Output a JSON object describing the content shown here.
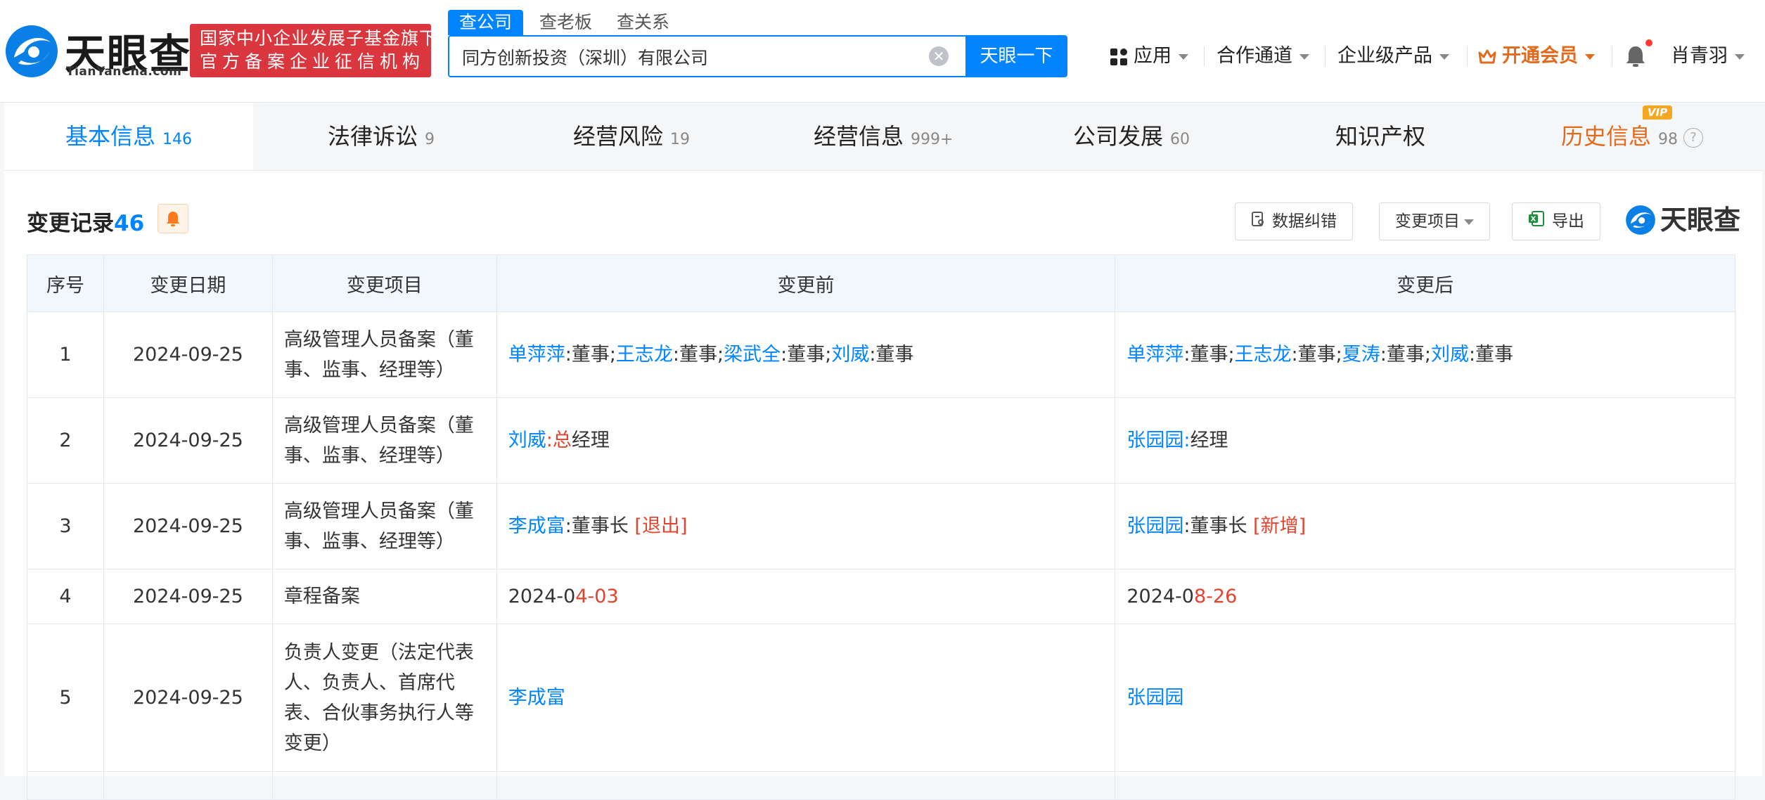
{
  "header": {
    "logo_cn": "天眼查",
    "logo_en": "TianYanCha.com",
    "badge_line1": "国家中小企业发展子基金旗下",
    "badge_line2": "官方备案企业征信机构",
    "search_tabs": [
      "查公司",
      "查老板",
      "查关系"
    ],
    "search_value": "同方创新投资（深圳）有限公司",
    "search_button": "天眼一下",
    "nav": {
      "apps": "应用",
      "cooperation": "合作通道",
      "enterprise": "企业级产品",
      "vip": "开通会员",
      "user": "肖青羽"
    },
    "accent_color": "#0084ff",
    "badge_color": "#d9363e"
  },
  "tabs": [
    {
      "label": "基本信息",
      "count": "146"
    },
    {
      "label": "法律诉讼",
      "count": "9"
    },
    {
      "label": "经营风险",
      "count": "19"
    },
    {
      "label": "经营信息",
      "count": "999+"
    },
    {
      "label": "公司发展",
      "count": "60"
    },
    {
      "label": "知识产权",
      "count": ""
    },
    {
      "label": "历史信息",
      "count": "98",
      "tag": "VIP"
    }
  ],
  "section": {
    "title": "变更记录",
    "count": "46",
    "buttons": {
      "correct": "数据纠错",
      "filter": "变更项目",
      "export": "导出"
    },
    "watermark": "天眼查"
  },
  "table": {
    "headers": [
      "序号",
      "变更日期",
      "变更项目",
      "变更前",
      "变更后"
    ],
    "rows": [
      {
        "no": "1",
        "date": "2024-09-25",
        "item": "高级管理人员备案（董事、监事、经理等）",
        "before": {
          "p1": "单萍萍",
          "t1": ":董事;",
          "p2": "王志龙",
          "t2": ":董事;",
          "p3": "梁武全",
          "t3": ":董事;",
          "p4": "刘威",
          "t4": ":董事"
        },
        "after": {
          "p1": "单萍萍",
          "t1": ":董事;",
          "p2": "王志龙",
          "t2": ":董事;",
          "p3": "夏涛",
          "t3": ":董事;",
          "p4": "刘威",
          "t4": ":董事"
        }
      },
      {
        "no": "2",
        "date": "2024-09-25",
        "item": "高级管理人员备案（董事、监事、经理等）",
        "before": {
          "name": "刘威",
          "hl": ":总",
          "rest": "经理"
        },
        "after": {
          "name": "张园园",
          "hl": ":",
          "rest": "经理"
        }
      },
      {
        "no": "3",
        "date": "2024-09-25",
        "item": "高级管理人员备案（董事、监事、经理等）",
        "before": {
          "name": "李成富",
          "rest": ":董事长 ",
          "tag": "[退出]"
        },
        "after": {
          "name": "张园园",
          "rest": ":董事长 ",
          "tag": "[新增]"
        }
      },
      {
        "no": "4",
        "date": "2024-09-25",
        "item": "章程备案",
        "before": {
          "a": "2024-0",
          "b": "4",
          "c": "-",
          "d": "03"
        },
        "after": {
          "a": "2024-0",
          "b": "8",
          "c": "-",
          "d": "26"
        }
      },
      {
        "no": "5",
        "date": "2024-09-25",
        "item": "负责人变更（法定代表人、负责人、首席代表、合伙事务执行人等变更）",
        "before": {
          "name": "李成富"
        },
        "after": {
          "name": "张园园"
        }
      }
    ]
  }
}
